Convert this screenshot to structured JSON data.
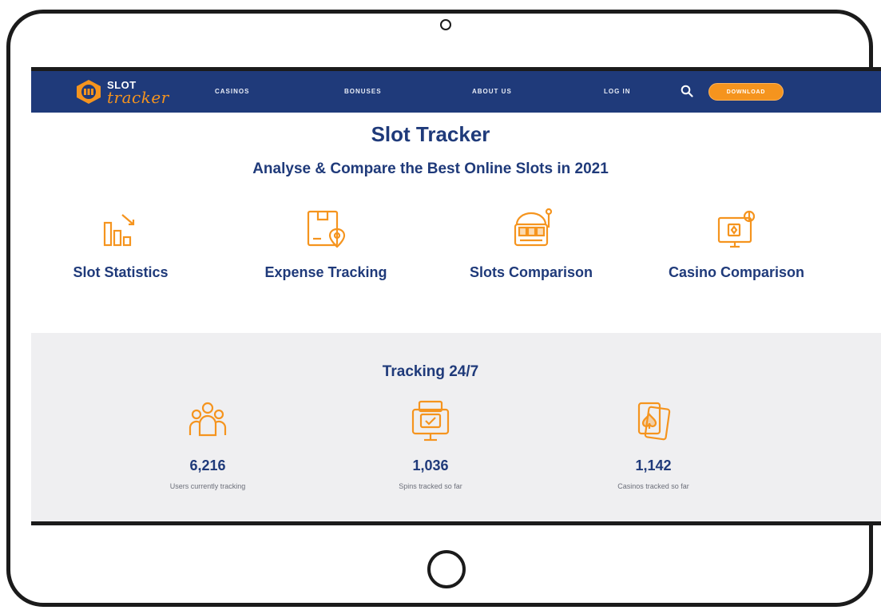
{
  "brand": {
    "logo_line1": "SLOT",
    "logo_line2": "tracker",
    "primary_color": "#1f3a7a",
    "accent_color": "#f5941e"
  },
  "nav": {
    "links": [
      {
        "label": "CASINOS"
      },
      {
        "label": "BONUSES"
      },
      {
        "label": "ABOUT US"
      },
      {
        "label": "LOG IN"
      }
    ],
    "search_icon": "search-icon",
    "download_label": "DOWNLOAD"
  },
  "hero": {
    "title": "Slot Tracker",
    "subtitle": "Analyse & Compare the Best Online Slots in 2021"
  },
  "features": [
    {
      "label": "Slot Statistics",
      "icon": "bar-chart-icon"
    },
    {
      "label": "Expense Tracking",
      "icon": "document-location-icon"
    },
    {
      "label": "Slots Comparison",
      "icon": "slot-machine-icon"
    },
    {
      "label": "Casino Comparison",
      "icon": "casino-screen-icon"
    }
  ],
  "tracking": {
    "title": "Tracking 24/7",
    "stats": [
      {
        "value": "6,216",
        "label": "Users currently tracking",
        "icon": "users-group-icon"
      },
      {
        "value": "1,036",
        "label": "Spins tracked so far",
        "icon": "monitor-icon"
      },
      {
        "value": "1,142",
        "label": "Casinos tracked so far",
        "icon": "playing-cards-icon"
      }
    ]
  }
}
